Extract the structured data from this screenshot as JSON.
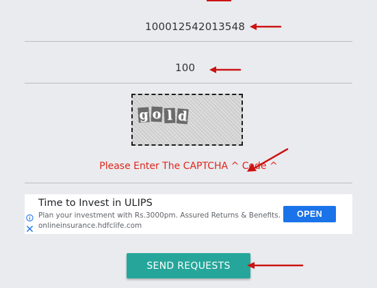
{
  "form": {
    "account_number": "100012542013548",
    "amount": "100",
    "captcha": {
      "characters": [
        "g",
        "o",
        "l",
        "d"
      ]
    },
    "error_message": "Please Enter The CAPTCHA ^ Code ^",
    "submit_label": "SEND REQUESTS"
  },
  "ad": {
    "title": "Time to Invest in ULIPS",
    "description": "Plan your investment with Rs.3000pm. Assured Returns & Benefits.",
    "url": "onlineinsurance.hdfclife.com",
    "button_label": "OPEN",
    "info_icon": "info-icon",
    "close_icon": "close-icon"
  },
  "colors": {
    "background": "#e9ebee",
    "error": "#e0241b",
    "annotation_arrow": "#cc1111",
    "send_button": "#26a69a",
    "ad_button": "#1a73e8",
    "ad_icon": "#1a73e8"
  }
}
